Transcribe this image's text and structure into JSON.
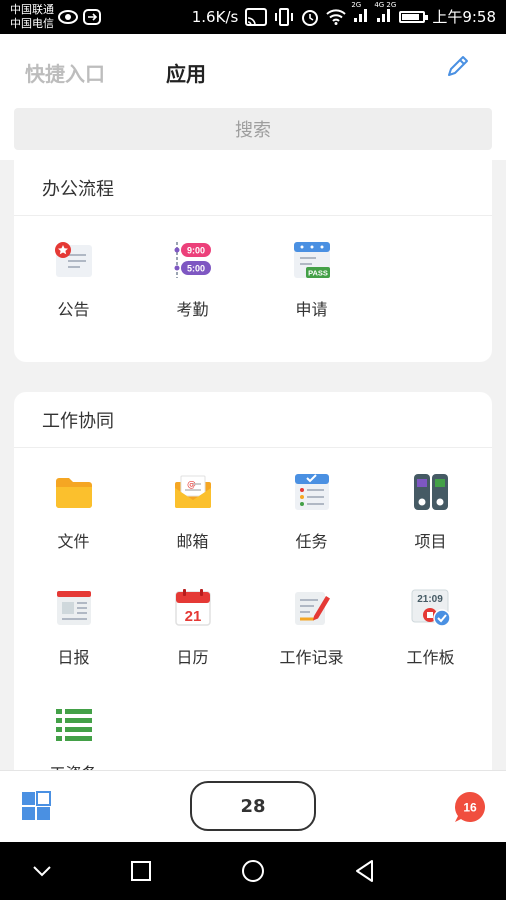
{
  "status_bar": {
    "carrier_1": "中国联通",
    "carrier_2": "中国电信",
    "speed": "1.6K/s",
    "net_1": "2G",
    "net_2": "4G 2G",
    "time": "上午9:58",
    "battery_level": 0.85
  },
  "header": {
    "tab_quick": "快捷入口",
    "tab_apps": "应用",
    "edit_icon": "pencil-icon"
  },
  "search": {
    "placeholder": "搜索"
  },
  "sections": {
    "office": {
      "title": "办公流程",
      "items": [
        {
          "label": "公告",
          "icon": "announcement-icon"
        },
        {
          "label": "考勤",
          "icon": "attendance-icon",
          "time_top": "9:00",
          "time_bottom": "5:00"
        },
        {
          "label": "申请",
          "icon": "application-icon",
          "stamp": "PASS"
        }
      ]
    },
    "collab": {
      "title": "工作协同",
      "items": [
        {
          "label": "文件",
          "icon": "folder-icon"
        },
        {
          "label": "邮箱",
          "icon": "mailbox-icon"
        },
        {
          "label": "任务",
          "icon": "task-icon"
        },
        {
          "label": "项目",
          "icon": "project-icon"
        },
        {
          "label": "日报",
          "icon": "daily-report-icon"
        },
        {
          "label": "日历",
          "icon": "calendar-icon",
          "day": "21"
        },
        {
          "label": "工作记录",
          "icon": "work-record-icon"
        },
        {
          "label": "工作板",
          "icon": "work-board-icon",
          "clock": "21:09"
        },
        {
          "label": "工资条",
          "icon": "payslip-icon"
        }
      ]
    }
  },
  "bottom_bar": {
    "page_number": "28",
    "message_badge": "16"
  },
  "colors": {
    "accent_blue": "#4a90e2",
    "badge_red": "#f04e3e"
  }
}
